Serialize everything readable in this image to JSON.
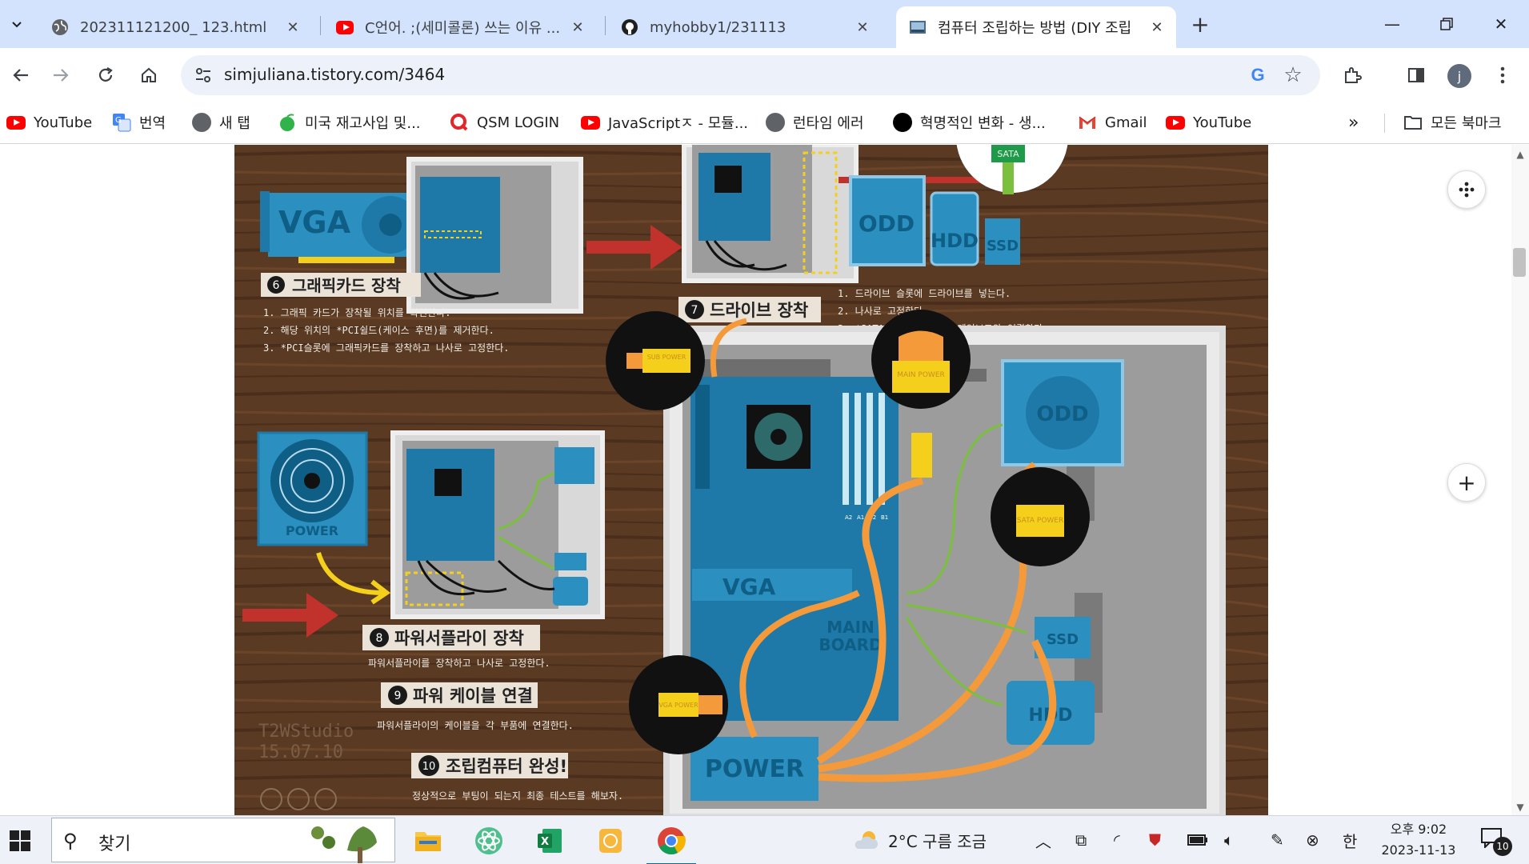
{
  "tabs": [
    {
      "title": "202311121200_ 123.html",
      "icon": "globe-icon"
    },
    {
      "title": "C언어. ;(세미콜론) 쓰는 이유 ...",
      "icon": "youtube-icon"
    },
    {
      "title": "myhobby1/231113",
      "icon": "github-icon"
    },
    {
      "title": "컴퓨터 조립하는 방법 (DIY 조립",
      "icon": "site-icon",
      "active": true
    }
  ],
  "address_bar": {
    "url": "simjuliana.tistory.com/3464"
  },
  "profile": {
    "initial": "j"
  },
  "bookmarks": [
    {
      "label": "YouTube",
      "icon": "youtube"
    },
    {
      "label": "번역",
      "icon": "translate"
    },
    {
      "label": "새 탭",
      "icon": "globe"
    },
    {
      "label": "미국 재고사입 및...",
      "icon": "leaf"
    },
    {
      "label": "QSM LOGIN",
      "icon": "qsm"
    },
    {
      "label": "JavaScriptㅈ - 모듈...",
      "icon": "youtube"
    },
    {
      "label": "런타임 에러",
      "icon": "globe"
    },
    {
      "label": "혁명적인 변화 - 생...",
      "icon": "dot"
    },
    {
      "label": "Gmail",
      "icon": "gmail"
    },
    {
      "label": "YouTube",
      "icon": "youtube"
    }
  ],
  "bookmarks_more": "»",
  "all_bookmarks": "모든 북마크",
  "infographic": {
    "colors": {
      "wood": "#5a3a23",
      "board": "#1e79a8",
      "yellow": "#f4d01c",
      "red": "#c0322b",
      "orange": "#f59a3a",
      "green": "#7bbf3e"
    },
    "vga_label": "VGA",
    "power_label": "POWER",
    "odd_label": "ODD",
    "hdd_label": "HDD",
    "ssd_label": "SSD",
    "sata_label": "SATA",
    "mainboard_label": "MAIN BOARD",
    "mainboard_line1": "MAIN",
    "mainboard_line2": "BOARD",
    "ram_labels": [
      "A2",
      "A1",
      "B2",
      "B1"
    ],
    "connectors": {
      "sub_power": "SUB POWER",
      "main_power": "MAIN POWER",
      "sata_power": "SATA POWER",
      "vga_power": "VGA POWER"
    },
    "step6": {
      "num": "6",
      "title": "그래픽카드 장착",
      "lines": [
        "1. 그래픽 카드가 장착될 위치를 확인한다.",
        "2. 해당 위치의 *PCI쉴드(케이스 후면)를 제거한다.",
        "3. *PCI슬롯에 그래픽카드를 장착하고 나사로 고정한다."
      ]
    },
    "step7": {
      "num": "7",
      "title": "드라이브 장착",
      "lines": [
        "1. 드라이브 슬롯에 드라이브를 넣는다.",
        "2. 나사로 고정한다.",
        "3. *SATA데이터 케이블을 메인보드와 연결한다."
      ]
    },
    "step8": {
      "num": "8",
      "title": "파워서플라이 장착",
      "desc": "파워서플라이를 장착하고 나사로 고정한다."
    },
    "step9": {
      "num": "9",
      "title": "파워 케이블 연결",
      "desc": "파워서플라이의 케이블을 각 부품에 연결한다."
    },
    "step10": {
      "num": "10",
      "title": "조립컴퓨터 완성!",
      "desc": "정상적으로 부팅이 되는지 최종 테스트를 해보자."
    },
    "watermark": [
      "T2WStudio",
      "15.07.10"
    ]
  },
  "taskbar": {
    "search_placeholder": "찾기",
    "weather": "2°C  구름 조금",
    "ime": "한",
    "time": "오후 9:02",
    "date": "2023-11-13",
    "notifications": "10"
  }
}
